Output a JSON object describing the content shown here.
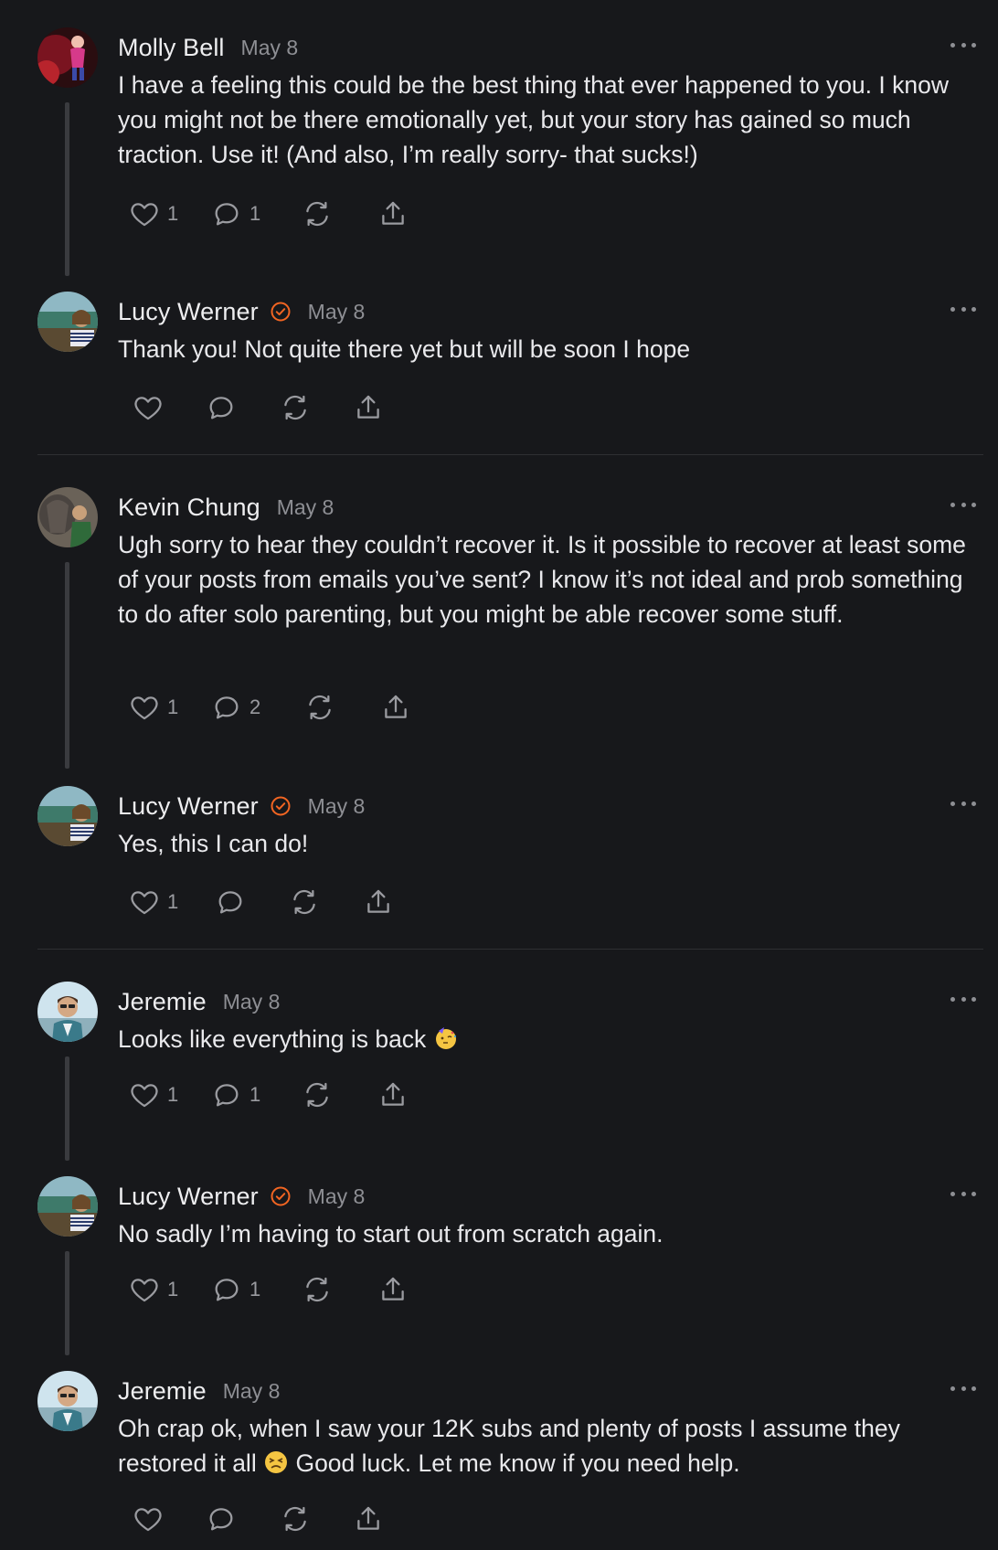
{
  "comments": [
    {
      "author": "Molly Bell",
      "verified": false,
      "date": "May 8",
      "text": "I have a feeling this could be the best thing that ever happened to you. I know you might not be there emotionally yet, but your story has gained so much traction. Use it! (And also, I’m really sorry- that sucks!)",
      "likes": "1",
      "replies": "1"
    },
    {
      "author": "Lucy Werner",
      "verified": true,
      "date": "May 8",
      "text": "Thank you! Not quite there yet but will be soon I hope",
      "likes": "",
      "replies": ""
    },
    {
      "author": "Kevin Chung",
      "verified": false,
      "date": "May 8",
      "text": "Ugh sorry to hear they couldn’t recover it. Is it possible to recover at least some of your posts from emails you’ve sent? I know it’s not ideal and prob something to do after solo parenting, but you might be able recover some stuff.",
      "likes": "1",
      "replies": "2"
    },
    {
      "author": "Lucy Werner",
      "verified": true,
      "date": "May 8",
      "text": "Yes, this I can do!",
      "likes": "1",
      "replies": ""
    },
    {
      "author": "Jeremie",
      "verified": false,
      "date": "May 8",
      "text": "Looks like everything is back",
      "emoji_after": "partying-face",
      "likes": "1",
      "replies": "1"
    },
    {
      "author": "Lucy Werner",
      "verified": true,
      "date": "May 8",
      "text": "No sadly I’m having to start out from scratch again.",
      "likes": "1",
      "replies": "1"
    },
    {
      "author": "Jeremie",
      "verified": false,
      "date": "May 8",
      "text_before": "Oh crap ok, when I saw your 12K subs and plenty of posts I assume they restored it all",
      "emoji_mid": "persevering-face",
      "text_after": "Good luck. Let me know if you need help.",
      "likes": "",
      "replies": ""
    }
  ],
  "colors": {
    "background": "#17181b",
    "verified_badge": "#f26522",
    "meta_text": "#8e8f94",
    "icon": "#9a9ba0"
  },
  "icons": [
    "heart-icon",
    "comment-icon",
    "restack-icon",
    "share-icon",
    "more-icon",
    "verified-icon"
  ]
}
